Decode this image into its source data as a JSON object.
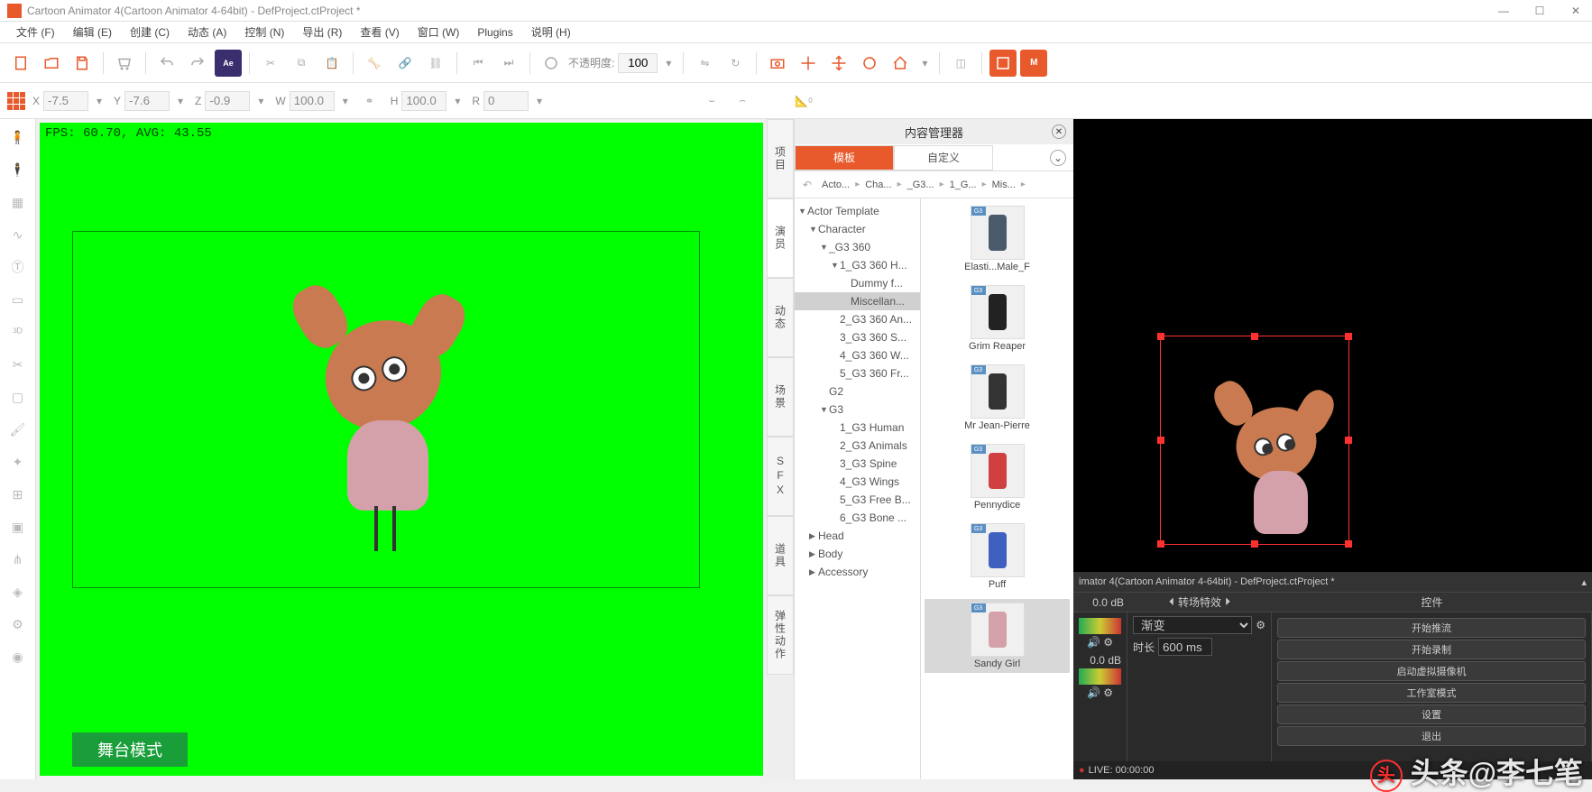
{
  "title": "Cartoon Animator 4(Cartoon Animator 4-64bit) - DefProject.ctProject *",
  "menu": [
    "文件 (F)",
    "编辑 (E)",
    "创建 (C)",
    "动态 (A)",
    "控制 (N)",
    "导出 (R)",
    "查看 (V)",
    "窗口 (W)",
    "Plugins",
    "说明 (H)"
  ],
  "opacity": {
    "label": "不透明度:",
    "value": "100"
  },
  "coords": {
    "x_label": "X",
    "x": "-7.5",
    "y_label": "Y",
    "y": "-7.6",
    "z_label": "Z",
    "z": "-0.9",
    "w_label": "W",
    "w": "100.0",
    "h_label": "H",
    "h": "100.0",
    "r_label": "R",
    "r": "0"
  },
  "fps": "FPS: 60.70, AVG: 43.55",
  "stage_mode": "舞台模式",
  "side_tabs": [
    "项目",
    "演员",
    "动态",
    "场景",
    "SFX",
    "道具",
    "弹性动作"
  ],
  "side_tab_active": 1,
  "panel": {
    "title": "内容管理器",
    "tabs": [
      "模板",
      "自定义"
    ],
    "tab_active": 0,
    "breadcrumb": [
      "Acto...",
      "Cha...",
      "_G3...",
      "1_G...",
      "Mis..."
    ],
    "tree": [
      {
        "label": "Actor Template",
        "indent": 0,
        "arrow": "▼"
      },
      {
        "label": "Character",
        "indent": 1,
        "arrow": "▼"
      },
      {
        "label": "_G3 360",
        "indent": 2,
        "arrow": "▼"
      },
      {
        "label": "1_G3 360 H...",
        "indent": 3,
        "arrow": "▼"
      },
      {
        "label": "Dummy f...",
        "indent": 4,
        "arrow": ""
      },
      {
        "label": "Miscellan...",
        "indent": 4,
        "arrow": "",
        "selected": true
      },
      {
        "label": "2_G3 360 An...",
        "indent": 3,
        "arrow": ""
      },
      {
        "label": "3_G3 360 S...",
        "indent": 3,
        "arrow": ""
      },
      {
        "label": "4_G3 360 W...",
        "indent": 3,
        "arrow": ""
      },
      {
        "label": "5_G3 360 Fr...",
        "indent": 3,
        "arrow": ""
      },
      {
        "label": "G2",
        "indent": 2,
        "arrow": ""
      },
      {
        "label": "G3",
        "indent": 2,
        "arrow": "▼"
      },
      {
        "label": "1_G3 Human",
        "indent": 3,
        "arrow": ""
      },
      {
        "label": "2_G3 Animals",
        "indent": 3,
        "arrow": ""
      },
      {
        "label": "3_G3 Spine",
        "indent": 3,
        "arrow": ""
      },
      {
        "label": "4_G3 Wings",
        "indent": 3,
        "arrow": ""
      },
      {
        "label": "5_G3 Free B...",
        "indent": 3,
        "arrow": ""
      },
      {
        "label": "6_G3 Bone ...",
        "indent": 3,
        "arrow": ""
      },
      {
        "label": "Head",
        "indent": 1,
        "arrow": "▶"
      },
      {
        "label": "Body",
        "indent": 1,
        "arrow": "▶"
      },
      {
        "label": "Accessory",
        "indent": 1,
        "arrow": "▶"
      }
    ],
    "thumbs": [
      {
        "label": "Elasti...Male_F",
        "color": "#4a5a6a"
      },
      {
        "label": "Grim Reaper",
        "color": "#222"
      },
      {
        "label": "Mr Jean-Pierre",
        "color": "#333"
      },
      {
        "label": "Pennydice",
        "color": "#d04040"
      },
      {
        "label": "Puff",
        "color": "#4060c0"
      },
      {
        "label": "Sandy Girl",
        "color": "#d4a0aa",
        "selected": true
      }
    ]
  },
  "obs": {
    "title": "imator 4(Cartoon Animator 4-64bit) - DefProject.ctProject *",
    "db": "0.0 dB",
    "trans_header": "转场特效",
    "ctrl_header": "控件",
    "fade": "渐变",
    "duration_label": "时长",
    "duration": "600 ms",
    "buttons": [
      "开始推流",
      "开始录制",
      "启动虚拟摄像机",
      "工作室模式",
      "设置",
      "退出"
    ],
    "live": "LIVE: 00:00:00"
  },
  "watermark": "头条@李七笔"
}
